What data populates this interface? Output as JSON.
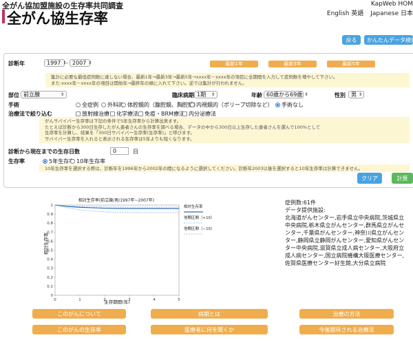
{
  "header": {
    "subtitle": "全がん協加盟施設の生存率共同調査",
    "title": "全がん協生存率",
    "kapweb": "KapWeb HOM",
    "lang_en": "English 英語",
    "lang_ja": "Japanese 日本"
  },
  "toolbar": {
    "back_label": "戻る",
    "simple_search_label": "かんたんデータ検索"
  },
  "form": {
    "diagnosis_year_label": "診断年",
    "year_from": "1997",
    "year_sep": "-",
    "year_to": "2007",
    "period_buttons": [
      "最新1年",
      "最新3年",
      "最新5年"
    ],
    "year_note": [
      "集計に必要な最低症例数に達しない場合、最新1年→最新3年→最新5年→xxxx年－xxxx年の項目に全期間を入力して症例数を増やして下さい。",
      "また:xxxx年－xxxx年の項目は開始年→最終年の順に入れて下さい。逆では集計が行われません。"
    ],
    "site_label": "部位",
    "site_value": "前立腺",
    "stage_label": "臨床病期",
    "stage_value": "1期",
    "age_label": "年齢",
    "age_value": "60歳から69歳",
    "sex_label": "性別",
    "sex_value": "男",
    "surgery_label": "手術",
    "surgery_options": [
      "全症例",
      "外科的",
      "体腔鏡的（腹腔鏡、胸腔鏡）",
      "内視鏡的（ポリープ切除など）",
      "手術なし"
    ],
    "surgery_selected": 4,
    "therapy_label": "治療法で絞り込む",
    "therapy_options": [
      "放射線治療",
      "化学療法",
      "免疫・BRM療法",
      "内分泌療法"
    ],
    "survivor_note": [
      "がんサバイバー生存率は下記の条件で5年生存率から計算出来ます。",
      "たとえば診断から300日生存したがん患者さんの生存率を調べる場合、データの中から300日以上生存した患者さんを選んで100%として",
      "生存率を計算し、結果を「300日サバイバー生存率(生存率)」と呼びます。",
      "サバイバー生存率を入れると表示される生存率は5年よりも短くなります。"
    ],
    "days_label": "診断から現在までの生存日数",
    "days_value": "0",
    "days_unit": "日",
    "rate_label": "生存率",
    "rate_options": [
      "5年生存率",
      "10年生存率"
    ],
    "rate_selected": 0,
    "rate_note": "10年生存率を選択する際は、診断年を1996年から2002年の間になるように選択してください。診断年2003以後を選択すると10年生存率は計算できません。",
    "clear_label": "クリア",
    "calc_label": "計算"
  },
  "chart_data": {
    "type": "line",
    "title": "相対生存率(前立腺/男/1997年~2007年)",
    "xlabel": "生存期間(年)",
    "ylabel": "相対生存率",
    "xlim": [
      0,
      5
    ],
    "ylim": [
      0,
      1
    ],
    "x_ticks": [
      "0",
      "1",
      "2",
      "3",
      "4",
      "5"
    ],
    "y_ticks": [
      "0",
      "0.1",
      "0.2",
      "0.3",
      "0.4",
      "0.5",
      "0.6",
      "0.7",
      "0.8",
      "0.9",
      "1"
    ],
    "series": [
      {
        "name": "相対生存率",
        "x": [
          0,
          0.5,
          1,
          1.5,
          2,
          2.5,
          3,
          3.5,
          4,
          4.5,
          5
        ],
        "values": [
          1.0,
          0.985,
          0.975,
          0.97,
          0.965,
          0.963,
          0.962,
          0.962,
          0.962,
          0.962,
          0.962
        ],
        "color": "#2b6cb0",
        "style": "solid"
      },
      {
        "name": "信頼区間（+1δ）",
        "x": [
          0,
          0.5,
          1,
          1.5,
          2,
          2.5,
          3,
          3.5,
          4,
          4.5,
          5
        ],
        "values": [
          1.0,
          0.99,
          0.985,
          0.982,
          0.98,
          0.978,
          0.977,
          0.977,
          0.977,
          0.977,
          0.977
        ],
        "color": "#7fb3e6",
        "style": "dashed"
      },
      {
        "name": "信頼区間（−1δ）",
        "x": [
          0,
          0.5,
          1,
          1.5,
          2,
          2.5,
          3,
          3.5,
          4,
          4.5,
          5
        ],
        "values": [
          1.0,
          0.97,
          0.945,
          0.935,
          0.925,
          0.92,
          0.918,
          0.917,
          0.917,
          0.917,
          0.917
        ],
        "color": "#7fb3e6",
        "style": "dashed"
      }
    ],
    "legend_position": "right"
  },
  "info": {
    "count": "症例数:61件",
    "facilities_label": "データ提供施設:",
    "facilities": "北海道がんセンター,岩手県立中央病院,茨城県立中央病院,栃木県立がんセンター,群馬県立がんセンター,千葉県がんセンター,神奈川県立がんセンター,静岡県立静岡がんセンター,愛知県がんセンター中央病院,滋賀県立成人病センター,大阪府立成人病センター,国立病院機構大阪医療センター,佐賀県医療センター好生館,大分県立病院"
  },
  "bottom_nav": [
    "このがんについて",
    "病期とは",
    "治療の方法",
    "このがんの生存率",
    "医療者に何を聞くか",
    "今後期待される治療法"
  ]
}
